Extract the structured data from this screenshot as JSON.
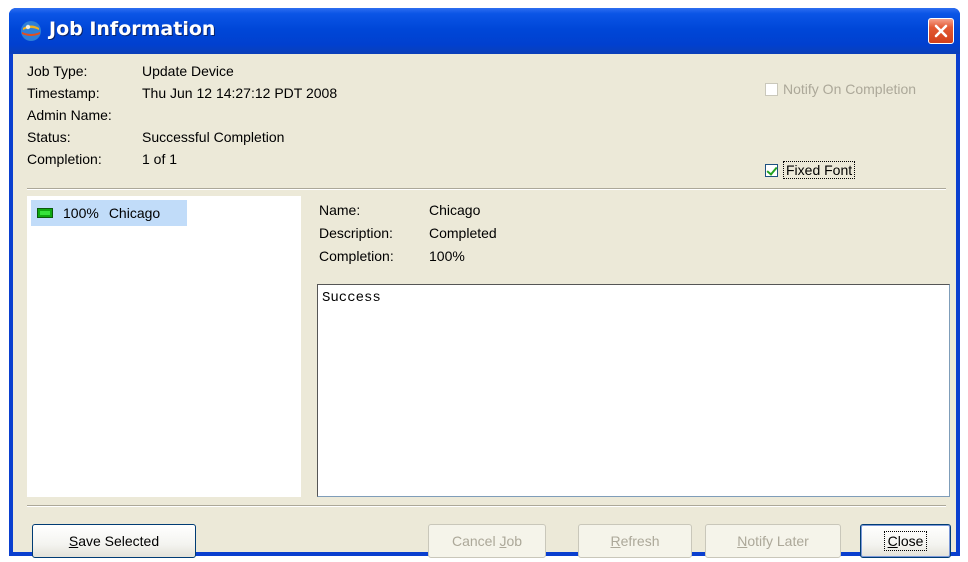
{
  "window": {
    "title": "Job Information"
  },
  "job": {
    "fields": [
      {
        "label": "Job Type:",
        "value": "Update Device"
      },
      {
        "label": "Timestamp:",
        "value": "Thu Jun 12 14:27:12 PDT 2008"
      },
      {
        "label": "Admin Name:",
        "value": ""
      },
      {
        "label": "Status:",
        "value": "Successful Completion"
      },
      {
        "label": "Completion:",
        "value": "1 of 1"
      }
    ]
  },
  "options": {
    "notify_on_completion": {
      "label": "Notify On Completion",
      "checked": false,
      "enabled": false
    },
    "fixed_font": {
      "label": "Fixed Font",
      "checked": true,
      "enabled": true
    }
  },
  "devices": {
    "items": [
      {
        "percent": "100%",
        "name": "Chicago",
        "selected": true
      }
    ]
  },
  "detail": {
    "fields": [
      {
        "label": "Name:",
        "value": "Chicago"
      },
      {
        "label": "Description:",
        "value": "Completed"
      },
      {
        "label": "Completion:",
        "value": "100%"
      }
    ],
    "output": "Success"
  },
  "buttons": {
    "save_selected": {
      "pre": "",
      "key": "S",
      "post": "ave Selected"
    },
    "cancel_job": {
      "pre": "Cancel ",
      "key": "J",
      "post": "ob"
    },
    "refresh": {
      "pre": "",
      "key": "R",
      "post": "efresh"
    },
    "notify_later": {
      "pre": "",
      "key": "N",
      "post": "otify Later"
    },
    "close": {
      "pre": "",
      "key": "C",
      "post": "lose"
    }
  },
  "colors": {
    "title_bar": "#0047d8",
    "client_background": "#ece9d8",
    "selection": "#c1dcf9",
    "close_button": "#d2401b",
    "progress_green": "#0fa80f"
  },
  "icons": {
    "title": "app-globe-icon",
    "close": "close-x-icon",
    "progress": "progress-bar-icon"
  }
}
